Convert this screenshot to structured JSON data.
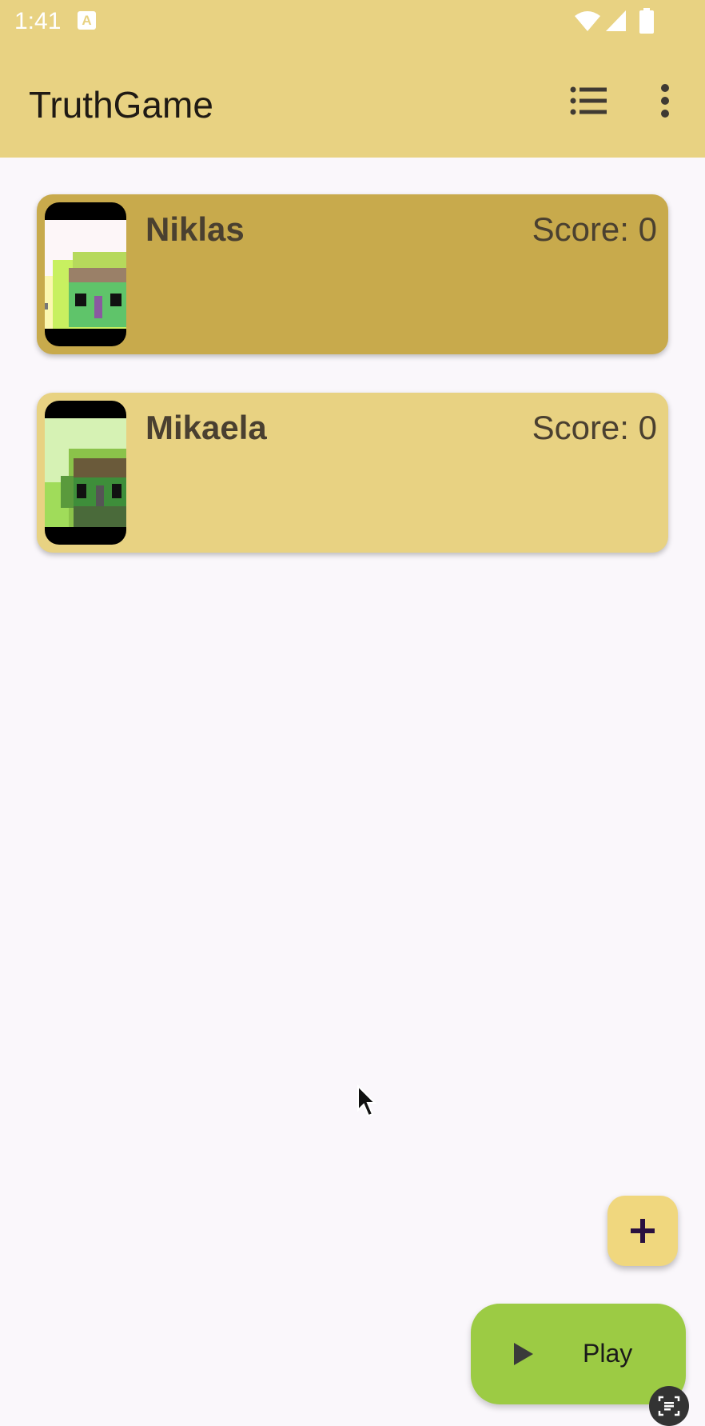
{
  "status_bar": {
    "time": "1:41",
    "notification_icon": "A"
  },
  "app_bar": {
    "title": "TruthGame",
    "list_icon": "list-icon",
    "more_icon": "more-vert-icon"
  },
  "players": [
    {
      "name": "Niklas",
      "score_label": "Score: 0",
      "selected": true
    },
    {
      "name": "Mikaela",
      "score_label": "Score: 0",
      "selected": false
    }
  ],
  "fab": {
    "icon": "add-icon"
  },
  "play_button": {
    "label": "Play",
    "icon": "play-icon"
  },
  "colors": {
    "app_bar": "#e8d282",
    "card_selected": "#c8aa4c",
    "card": "#e8d282",
    "play_button": "#9ccb44",
    "background": "#faf7fb"
  }
}
